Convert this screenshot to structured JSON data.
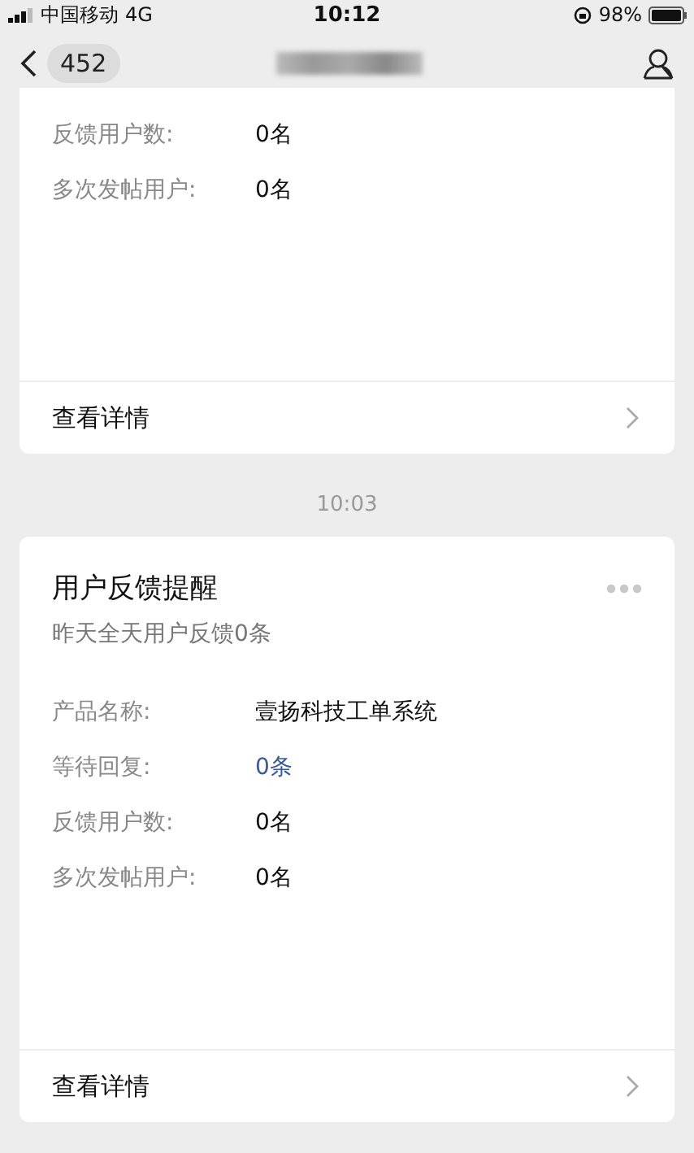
{
  "status_bar": {
    "carrier": "中国移动",
    "network": "4G",
    "time": "10:12",
    "battery": "98%"
  },
  "nav_bar": {
    "badge": "452"
  },
  "messages": [
    {
      "kind": "card",
      "rows": [
        {
          "label": "反馈用户数:",
          "value": "0名",
          "kind": "plain"
        },
        {
          "label": "多次发帖用户:",
          "value": "0名",
          "kind": "plain"
        }
      ],
      "footer": "查看详情"
    },
    {
      "kind": "time",
      "time": "10:03"
    },
    {
      "kind": "card",
      "title": "用户反馈提醒",
      "subtitle": "昨天全天用户反馈0条",
      "rows": [
        {
          "label": "产品名称:",
          "value": "壹扬科技工单系统",
          "kind": "plain"
        },
        {
          "label": "等待回复:",
          "value": "0条",
          "kind": "link"
        },
        {
          "label": "反馈用户数:",
          "value": "0名",
          "kind": "plain"
        },
        {
          "label": "多次发帖用户:",
          "value": "0名",
          "kind": "plain"
        }
      ],
      "footer": "查看详情"
    }
  ]
}
